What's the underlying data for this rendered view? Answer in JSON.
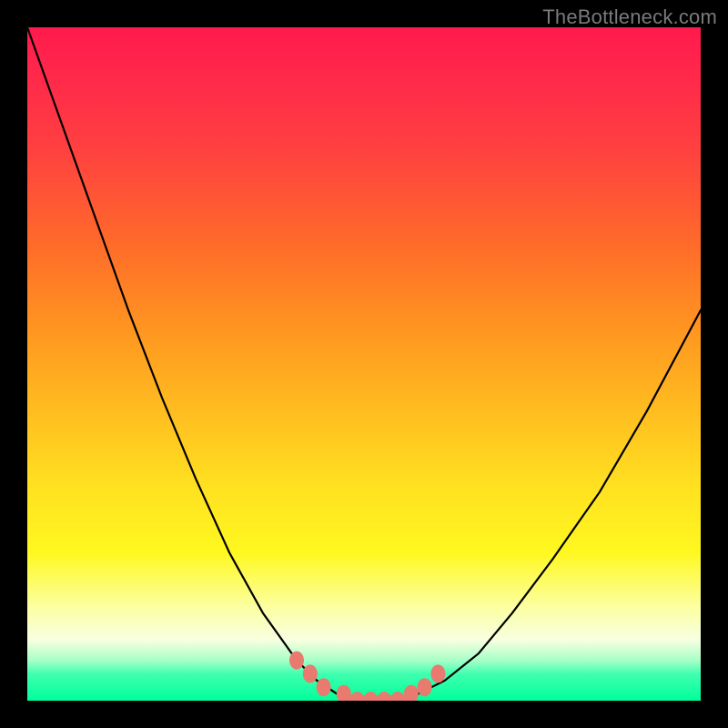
{
  "watermark": "TheBottleneck.com",
  "chart_data": {
    "type": "line",
    "title": "",
    "xlabel": "",
    "ylabel": "",
    "xlim": [
      0,
      100
    ],
    "ylim": [
      0,
      100
    ],
    "series": [
      {
        "name": "bottleneck-curve",
        "x": [
          0,
          5,
          10,
          15,
          20,
          25,
          30,
          35,
          40,
          43,
          46,
          49,
          52,
          55,
          58,
          62,
          67,
          72,
          78,
          85,
          92,
          100
        ],
        "values": [
          100,
          86,
          72,
          58,
          45,
          33,
          22,
          13,
          6,
          3,
          1,
          0,
          0,
          0,
          1,
          3,
          7,
          13,
          21,
          31,
          43,
          58
        ]
      }
    ],
    "markers": {
      "name": "trough-markers",
      "x": [
        40,
        42,
        44,
        47,
        49,
        51,
        53,
        55,
        57,
        59,
        61
      ],
      "values": [
        6,
        4,
        2,
        1,
        0,
        0,
        0,
        0,
        1,
        2,
        4
      ],
      "color": "#e87a6f",
      "segment": {
        "x0": 47,
        "x1": 57,
        "thickness": 12
      }
    },
    "gradient_stops": [
      {
        "pos": 0.0,
        "color": "#ff1a4d"
      },
      {
        "pos": 0.45,
        "color": "#ff9620"
      },
      {
        "pos": 0.78,
        "color": "#fff820"
      },
      {
        "pos": 0.94,
        "color": "#a8ffc8"
      },
      {
        "pos": 1.0,
        "color": "#00ff9a"
      }
    ]
  }
}
